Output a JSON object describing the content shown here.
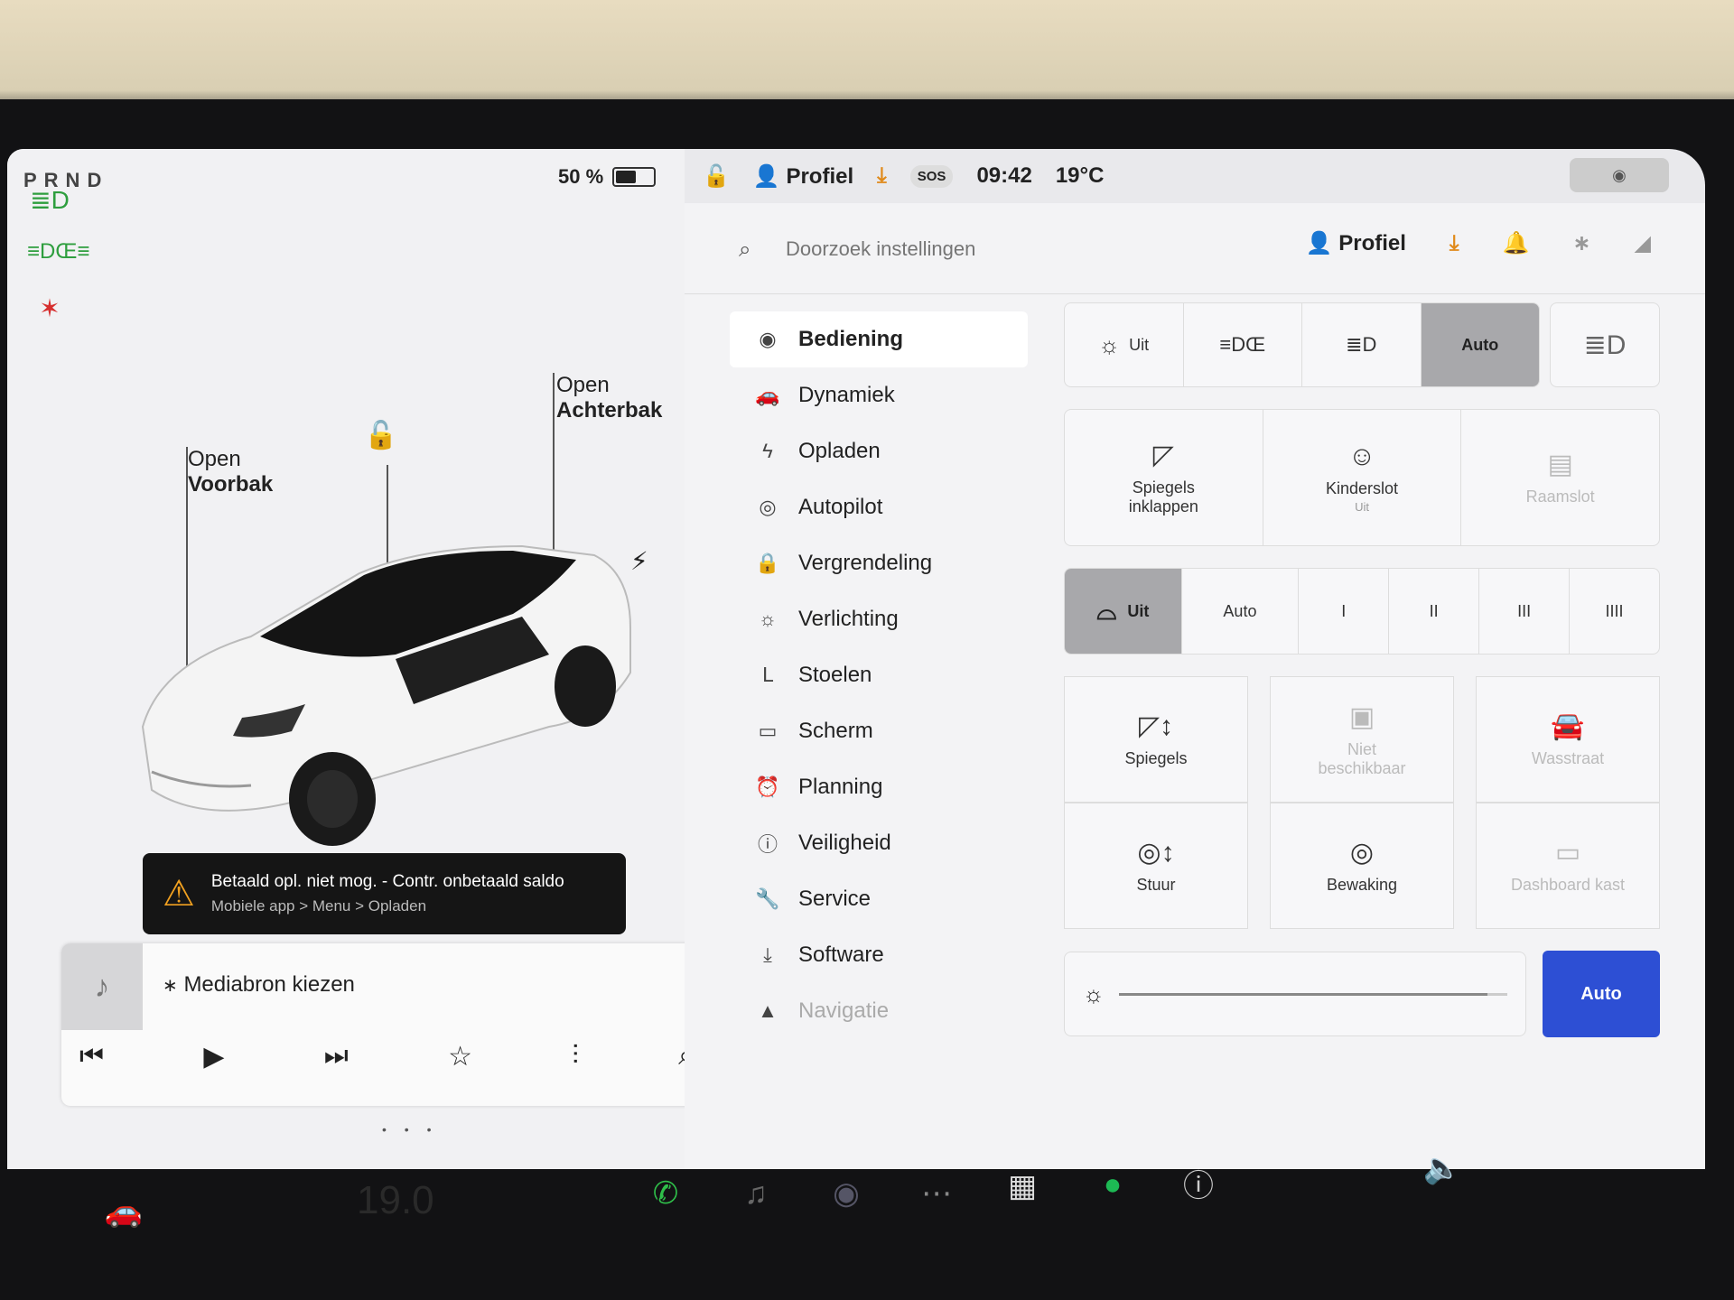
{
  "left": {
    "gear": "PRND",
    "battery_pct": "50 %",
    "battery_level": 0.5,
    "frunk": {
      "line1": "Open",
      "line2": "Voorbak"
    },
    "trunk": {
      "line1": "Open",
      "line2": "Achterbak"
    },
    "alert": {
      "title": "Betaald opl. niet mog. - Contr. onbetaald saldo",
      "subtitle": "Mobiele app > Menu > Opladen"
    },
    "media_source": "Mediabron kiezen"
  },
  "topbar": {
    "profile": "Profiel",
    "sos": "SOS",
    "time": "09:42",
    "temperature": "19°C"
  },
  "settings": {
    "search_placeholder": "Doorzoek instellingen",
    "profile": "Profiel",
    "nav": [
      {
        "label": "Bediening",
        "icon": "toggle-icon"
      },
      {
        "label": "Dynamiek",
        "icon": "car-icon"
      },
      {
        "label": "Opladen",
        "icon": "bolt-icon"
      },
      {
        "label": "Autopilot",
        "icon": "steering-wheel-icon"
      },
      {
        "label": "Vergrendeling",
        "icon": "lock-icon"
      },
      {
        "label": "Verlichting",
        "icon": "light-icon"
      },
      {
        "label": "Stoelen",
        "icon": "seat-icon"
      },
      {
        "label": "Scherm",
        "icon": "display-icon"
      },
      {
        "label": "Planning",
        "icon": "alarm-icon"
      },
      {
        "label": "Veiligheid",
        "icon": "info-circle-icon"
      },
      {
        "label": "Service",
        "icon": "wrench-icon"
      },
      {
        "label": "Software",
        "icon": "download-icon"
      },
      {
        "label": "Navigatie",
        "icon": "navigation-icon"
      }
    ],
    "lights": {
      "off": "Uit",
      "auto": "Auto"
    },
    "row3": {
      "fold_mirrors": "Spiegels inklappen",
      "child_lock": "Kinderslot",
      "child_lock_state": "Uit",
      "window_lock": "Raamslot"
    },
    "wipers": {
      "off": "Uit",
      "auto": "Auto",
      "l1": "I",
      "l2": "II",
      "l3": "III",
      "l4": "IIII"
    },
    "grid": {
      "mirrors": "Spiegels",
      "not_available": "Niet beschikbaar",
      "car_wash": "Wasstraat",
      "steering": "Stuur",
      "sentry": "Bewaking",
      "glovebox": "Dashboard kast"
    },
    "brightness_auto": "Auto",
    "brightness_level": 0.95
  },
  "dock": {
    "temperature": "19.0"
  }
}
